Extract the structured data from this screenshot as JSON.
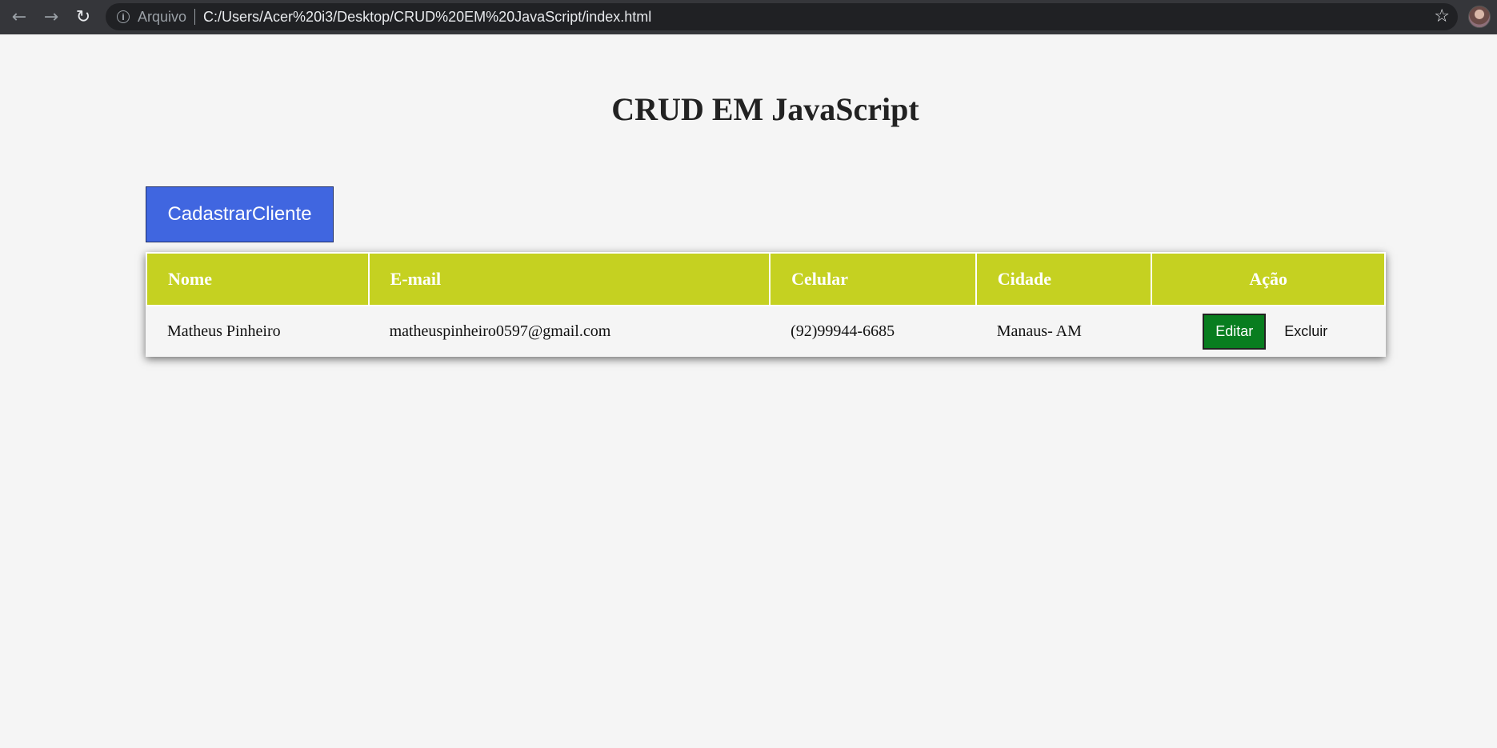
{
  "browser": {
    "scheme_label": "Arquivo",
    "url": "C:/Users/Acer%20i3/Desktop/CRUD%20EM%20JavaScript/index.html"
  },
  "page": {
    "title": "CRUD EM JavaScript",
    "register_button": "CadastrarCliente"
  },
  "table": {
    "headers": {
      "nome": "Nome",
      "email": "E-mail",
      "celular": "Celular",
      "cidade": "Cidade",
      "acao": "Ação"
    },
    "rows": [
      {
        "nome": "Matheus Pinheiro",
        "email": "matheuspinheiro0597@gmail.com",
        "celular": "(92)99944-6685",
        "cidade": "Manaus- AM",
        "edit_label": "Editar",
        "delete_label": "Excluir"
      }
    ]
  },
  "colors": {
    "header_bg": "#c5d121",
    "register_button_bg": "#4066e0",
    "edit_button_bg": "#087d1f",
    "page_bg": "#f5f5f5"
  },
  "icons": [
    "back-arrow-icon",
    "forward-arrow-icon",
    "reload-icon",
    "info-icon",
    "star-icon",
    "profile-avatar"
  ]
}
